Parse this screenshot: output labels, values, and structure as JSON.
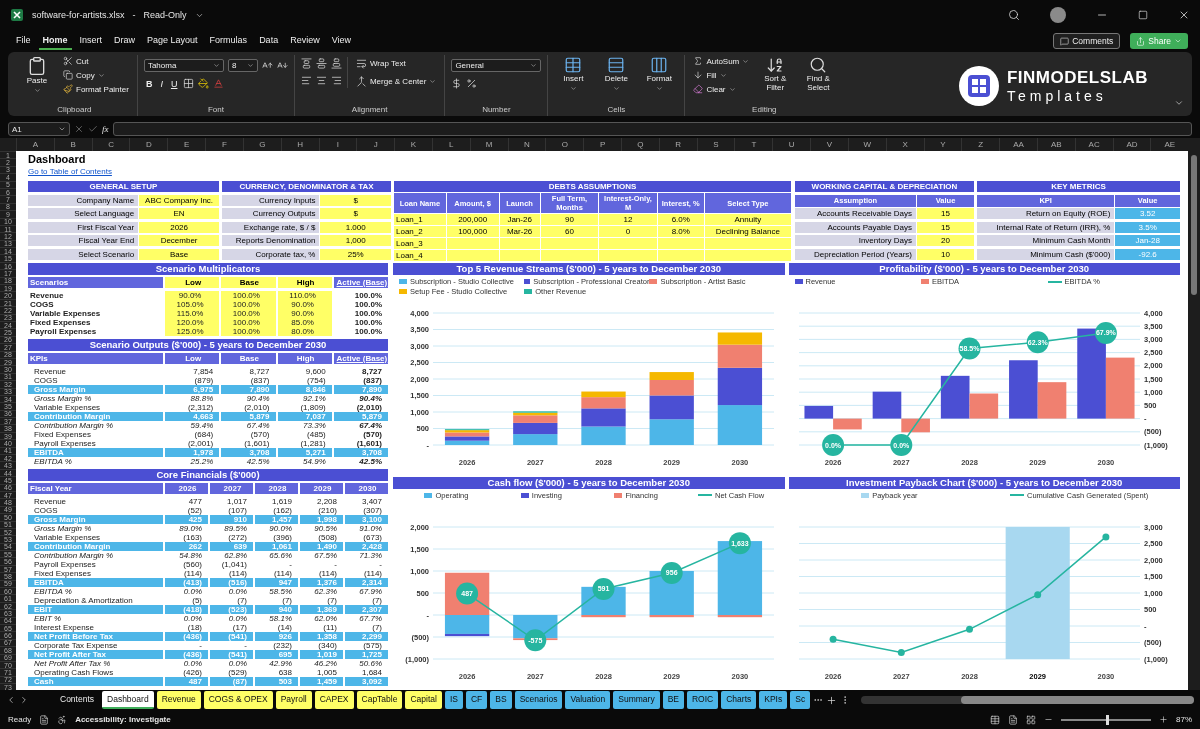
{
  "title_bar": {
    "file": "software-for-artists.xlsx",
    "separator": "-",
    "mode": "Read-Only"
  },
  "menu": [
    {
      "label": "File",
      "selected": false
    },
    {
      "label": "Home",
      "selected": true
    },
    {
      "label": "Insert",
      "selected": false
    },
    {
      "label": "Draw",
      "selected": false
    },
    {
      "label": "Page Layout",
      "selected": false
    },
    {
      "label": "Formulas",
      "selected": false
    },
    {
      "label": "Data",
      "selected": false
    },
    {
      "label": "Review",
      "selected": false
    },
    {
      "label": "View",
      "selected": false
    }
  ],
  "menu_actions": {
    "comments": "Comments",
    "share": "Share"
  },
  "ribbon": {
    "clipboard": {
      "paste": "Paste",
      "cut": "Cut",
      "copy": "Copy",
      "format_painter": "Format Painter",
      "label": "Clipboard"
    },
    "font": {
      "family": "Tahoma",
      "size": "8",
      "styles": [
        "B",
        "I",
        "U"
      ],
      "label": "Font"
    },
    "alignment": {
      "wrap": "Wrap Text",
      "merge": "Merge & Center",
      "label": "Alignment"
    },
    "number": {
      "format": "General",
      "label": "Number"
    },
    "cells": {
      "buttons": [
        "Insert",
        "Delete",
        "Format"
      ],
      "label": "Cells"
    },
    "editing": {
      "autosum": "AutoSum",
      "fill": "Fill",
      "clear": "Clear",
      "sort": "Sort & Filter",
      "find": "Find & Select",
      "label": "Editing"
    },
    "logo": {
      "name": "FINMODELSLAB",
      "tagline": "Templates"
    }
  },
  "formula_bar": {
    "cell": "A1",
    "fx": "fx"
  },
  "columns": [
    "A",
    "B",
    "C",
    "D",
    "E",
    "F",
    "G",
    "H",
    "I",
    "J",
    "K",
    "L",
    "M",
    "N",
    "O",
    "P",
    "Q",
    "R",
    "S",
    "T",
    "U",
    "V",
    "W",
    "X",
    "Y",
    "Z",
    "AA",
    "AB",
    "AC",
    "AD",
    "AE"
  ],
  "rows": [
    "1",
    "2",
    "3",
    "4",
    "5",
    "6",
    "7",
    "8",
    "9",
    "10",
    "11",
    "12",
    "13",
    "14",
    "15",
    "16",
    "17",
    "18",
    "19",
    "20",
    "21",
    "22",
    "23",
    "24",
    "25",
    "26",
    "27",
    "28",
    "29",
    "30",
    "31",
    "32",
    "33",
    "34",
    "35",
    "36",
    "37",
    "38",
    "39",
    "40",
    "41",
    "42",
    "43",
    "44",
    "45",
    "46",
    "47",
    "48",
    "49",
    "50",
    "51",
    "52",
    "53",
    "54",
    "55",
    "56",
    "57",
    "58",
    "59",
    "60",
    "61",
    "62",
    "63",
    "64",
    "65",
    "66",
    "67",
    "68",
    "69",
    "70",
    "71",
    "72",
    "73"
  ],
  "sheet": {
    "title": "Dashboard",
    "link": "Go to Table of Contents",
    "general_setup": {
      "title": "GENERAL SETUP",
      "rows": [
        {
          "label": "Company Name",
          "value": "ABC Company Inc."
        },
        {
          "label": "Select Language",
          "value": "EN"
        },
        {
          "label": "First Fiscal Year",
          "value": "2026"
        },
        {
          "label": "Fiscal Year End",
          "value": "December"
        },
        {
          "label": "Select Scenario",
          "value": "Base"
        }
      ]
    },
    "currency": {
      "title": "CURRENCY, DENOMINATOR & TAX",
      "rows": [
        {
          "label": "Currency Inputs",
          "value": "$"
        },
        {
          "label": "Currency Outputs",
          "value": "$"
        },
        {
          "label": "Exchange rate, $ / $",
          "value": "1.000"
        },
        {
          "label": "Reports Denomination",
          "value": "1,000"
        },
        {
          "label": "Corporate tax, %",
          "value": "25%"
        }
      ]
    },
    "debts": {
      "title": "DEBTS ASSUMPTIONS",
      "columns": [
        "Loan Name",
        "Amount, $",
        "Launch",
        "Full Term, Months",
        "Interest-Only, M",
        "Interest, %",
        "Select Type"
      ],
      "rows": [
        {
          "cells": [
            "Loan_1",
            "200,000",
            "Jan-26",
            "90",
            "12",
            "6.0%",
            "Annuity"
          ]
        },
        {
          "cells": [
            "Loan_2",
            "100,000",
            "Mar-26",
            "60",
            "0",
            "8.0%",
            "Declining Balance"
          ]
        },
        {
          "cells": [
            "Loan_3"
          ]
        },
        {
          "cells": [
            "Loan_4"
          ]
        }
      ]
    },
    "working_capital": {
      "title": "WORKING CAPITAL & DEPRECIATION",
      "kind": "input",
      "columns": [
        "Assumption",
        "Value"
      ],
      "rows": [
        {
          "label": "Accounts Receivable Days",
          "value": "15"
        },
        {
          "label": "Accounts Payable Days",
          "value": "15"
        },
        {
          "label": "Inventory Days",
          "value": "20"
        },
        {
          "label": "Depreciation Period (Years)",
          "value": "10"
        }
      ]
    },
    "key_metrics": {
      "title": "KEY METRICS",
      "kind": "output",
      "columns": [
        "KPI",
        "Value"
      ],
      "rows": [
        {
          "label": "Return on Equity (ROE)",
          "value": "3.52"
        },
        {
          "label": "Internal Rate of Return (IRR), %",
          "value": "3.5%"
        },
        {
          "label": "Minimum Cash Month",
          "value": "Jan-28"
        },
        {
          "label": "Minimum Cash ($'000)",
          "value": "-92.6"
        }
      ]
    },
    "tables": [
      {
        "title": "Scenario Multiplicators",
        "kind": "input",
        "emphasize_last": true,
        "columns": [
          "Scenarios",
          "Low",
          "Base",
          "High",
          "Active (Base)"
        ],
        "rows": [
          {
            "kind": "item",
            "cells": [
              "Revenue",
              "90.0%",
              "100.0%",
              "110.0%",
              "100.0%"
            ]
          },
          {
            "kind": "item",
            "cells": [
              "COGS",
              "105.0%",
              "100.0%",
              "90.0%",
              "100.0%"
            ]
          },
          {
            "kind": "item",
            "cells": [
              "Variable Expenses",
              "115.0%",
              "100.0%",
              "90.0%",
              "100.0%"
            ]
          },
          {
            "kind": "item",
            "cells": [
              "Fixed Expenses",
              "120.0%",
              "100.0%",
              "85.0%",
              "100.0%"
            ]
          },
          {
            "kind": "item",
            "cells": [
              "Payroll Expenses",
              "125.0%",
              "100.0%",
              "80.0%",
              "100.0%"
            ]
          }
        ]
      },
      {
        "title": "Scenario Outputs ($'000) - 5 years to December 2030",
        "kind": "output",
        "emphasize_last": true,
        "columns": [
          "KPIs",
          "Low",
          "Base",
          "High",
          "Active (Base)"
        ],
        "rows": [
          {
            "kind": "line",
            "cells": [
              "Revenue",
              "7,854",
              "8,727",
              "9,600",
              "8,727"
            ]
          },
          {
            "kind": "line",
            "cells": [
              "COGS",
              "(879)",
              "(837)",
              "(754)",
              "(837)"
            ]
          },
          {
            "kind": "total",
            "cells": [
              "Gross Margin",
              "6,975",
              "7,890",
              "8,846",
              "7,890"
            ]
          },
          {
            "kind": "pct",
            "cells": [
              "Gross Margin %",
              "88.8%",
              "90.4%",
              "92.1%",
              "90.4%"
            ]
          },
          {
            "kind": "line",
            "cells": [
              "Variable Expenses",
              "(2,312)",
              "(2,010)",
              "(1,809)",
              "(2,010)"
            ]
          },
          {
            "kind": "total",
            "cells": [
              "Contribution Margin",
              "4,663",
              "5,879",
              "7,037",
              "5,879"
            ]
          },
          {
            "kind": "pct",
            "cells": [
              "Contribution Margin %",
              "59.4%",
              "67.4%",
              "73.3%",
              "67.4%"
            ]
          },
          {
            "kind": "line",
            "cells": [
              "Fixed Expenses",
              "(684)",
              "(570)",
              "(485)",
              "(570)"
            ]
          },
          {
            "kind": "line",
            "cells": [
              "Payroll Expenses",
              "(2,001)",
              "(1,601)",
              "(1,281)",
              "(1,601)"
            ]
          },
          {
            "kind": "total",
            "cells": [
              "EBITDA",
              "1,978",
              "3,708",
              "5,271",
              "3,708"
            ]
          },
          {
            "kind": "pct",
            "cells": [
              "EBITDA %",
              "25.2%",
              "42.5%",
              "54.9%",
              "42.5%"
            ]
          }
        ]
      },
      {
        "title": "Core Financials ($'000)",
        "kind": "output",
        "emphasize_last": false,
        "columns": [
          "Fiscal Year",
          "2026",
          "2027",
          "2028",
          "2029",
          "2030"
        ],
        "rows": [
          {
            "kind": "line",
            "cells": [
              "Revenue",
              "477",
              "1,017",
              "1,619",
              "2,208",
              "3,407"
            ]
          },
          {
            "kind": "line",
            "cells": [
              "COGS",
              "(52)",
              "(107)",
              "(162)",
              "(210)",
              "(307)"
            ]
          },
          {
            "kind": "total",
            "cells": [
              "Gross Margin",
              "425",
              "910",
              "1,457",
              "1,998",
              "3,100"
            ]
          },
          {
            "kind": "pct",
            "cells": [
              "Gross Margin %",
              "89.0%",
              "89.5%",
              "90.0%",
              "90.5%",
              "91.0%"
            ]
          },
          {
            "kind": "line",
            "cells": [
              "Variable Expenses",
              "(163)",
              "(272)",
              "(396)",
              "(508)",
              "(673)"
            ]
          },
          {
            "kind": "total",
            "cells": [
              "Contribution Margin",
              "262",
              "639",
              "1,061",
              "1,490",
              "2,428"
            ]
          },
          {
            "kind": "pct",
            "cells": [
              "Contribution Margin %",
              "54.8%",
              "62.8%",
              "65.6%",
              "67.5%",
              "71.3%"
            ]
          },
          {
            "kind": "line",
            "cells": [
              "Payroll Expenses",
              "(560)",
              "(1,041)",
              "-",
              "-",
              "-"
            ]
          },
          {
            "kind": "line",
            "cells": [
              "Fixed Expenses",
              "(114)",
              "(114)",
              "(114)",
              "(114)",
              "(114)"
            ]
          },
          {
            "kind": "total",
            "cells": [
              "EBITDA",
              "(413)",
              "(516)",
              "947",
              "1,376",
              "2,314"
            ]
          },
          {
            "kind": "pct",
            "cells": [
              "EBITDA %",
              "0.0%",
              "0.0%",
              "58.5%",
              "62.3%",
              "67.9%"
            ]
          },
          {
            "kind": "line",
            "cells": [
              "Depreciation & Amortization",
              "(5)",
              "(7)",
              "(7)",
              "(7)",
              "(7)"
            ]
          },
          {
            "kind": "total",
            "cells": [
              "EBIT",
              "(418)",
              "(523)",
              "940",
              "1,369",
              "2,307"
            ]
          },
          {
            "kind": "pct",
            "cells": [
              "EBIT %",
              "0.0%",
              "0.0%",
              "58.1%",
              "62.0%",
              "67.7%"
            ]
          },
          {
            "kind": "line",
            "cells": [
              "Interest Expense",
              "(18)",
              "(17)",
              "(14)",
              "(11)",
              "(7)"
            ]
          },
          {
            "kind": "total",
            "cells": [
              "Net Profit Before Tax",
              "(436)",
              "(541)",
              "926",
              "1,358",
              "2,299"
            ]
          },
          {
            "kind": "line",
            "cells": [
              "Corporate Tax Expense",
              "-",
              "-",
              "(232)",
              "(340)",
              "(575)"
            ]
          },
          {
            "kind": "total",
            "cells": [
              "Net Profit After Tax",
              "(436)",
              "(541)",
              "695",
              "1,019",
              "1,725"
            ]
          },
          {
            "kind": "pct",
            "cells": [
              "Net Profit After Tax %",
              "0.0%",
              "0.0%",
              "42.9%",
              "46.2%",
              "50.6%"
            ]
          },
          {
            "kind": "line",
            "cells": [
              "Operating Cash Flows",
              "(426)",
              "(529)",
              "638",
              "1,005",
              "1,684"
            ]
          },
          {
            "kind": "total",
            "cells": [
              "Cash",
              "487",
              "(87)",
              "503",
              "1,459",
              "3,092"
            ]
          }
        ]
      }
    ],
    "charts": [
      {
        "chart_data": {
          "type": "bar",
          "stacked": true,
          "grid": true,
          "legend": true,
          "title": "Top 5 Revenue Streams ($'000) - 5 years to December 2030",
          "categories": [
            "2026",
            "2027",
            "2028",
            "2029",
            "2030"
          ],
          "ylim": [
            0,
            4000
          ],
          "yticks": [
            {
              "value": 0,
              "label": "-"
            },
            {
              "value": 500,
              "label": "500"
            },
            {
              "value": 1000,
              "label": "1,000"
            },
            {
              "value": 1500,
              "label": "1,500"
            },
            {
              "value": 2000,
              "label": "2,000"
            },
            {
              "value": 2500,
              "label": "2,500"
            },
            {
              "value": 3000,
              "label": "3,000"
            },
            {
              "value": 3500,
              "label": "3,500"
            },
            {
              "value": 4000,
              "label": "4,000"
            }
          ],
          "series": [
            {
              "name": "Subscription - Studio Collective",
              "color": "#4db6e8",
              "values": [
                130,
                330,
                560,
                780,
                1210
              ]
            },
            {
              "name": "Subscription - Professional Creator",
              "color": "#4b4fd3",
              "values": [
                130,
                340,
                550,
                720,
                1130
              ]
            },
            {
              "name": "Subscription - Artist Basic",
              "color": "#f08070",
              "values": [
                120,
                230,
                340,
                470,
                700
              ]
            },
            {
              "name": "Setup Fee - Studio Collective",
              "color": "#f5b800",
              "values": [
                70,
                80,
                170,
                240,
                370
              ]
            },
            {
              "name": "Other Revenue",
              "color": "#26b5a0",
              "values": [
                30,
                40,
                0,
                0,
                0
              ]
            }
          ]
        }
      },
      {
        "chart_data": {
          "type": "bar",
          "grid": true,
          "legend": true,
          "title": "Profitability ($'000) - 5 years to December 2030",
          "categories": [
            "2026",
            "2027",
            "2028",
            "2029",
            "2030"
          ],
          "ylim": [
            -1000,
            4000
          ],
          "y2lim": [
            0,
            80
          ],
          "yticks": [
            {
              "value": -1000,
              "label": "(1,000)"
            },
            {
              "value": -500,
              "label": "(500)"
            },
            {
              "value": 0,
              "label": "-"
            },
            {
              "value": 500,
              "label": "500"
            },
            {
              "value": 1000,
              "label": "1,000"
            },
            {
              "value": 1500,
              "label": "1,500"
            },
            {
              "value": 2000,
              "label": "2,000"
            },
            {
              "value": 2500,
              "label": "2,500"
            },
            {
              "value": 3000,
              "label": "3,000"
            },
            {
              "value": 3500,
              "label": "3,500"
            },
            {
              "value": 4000,
              "label": "4,000"
            }
          ],
          "series": [
            {
              "name": "Revenue",
              "color": "#4b4fd3",
              "values": [
                480,
                1020,
                1620,
                2210,
                3410
              ]
            },
            {
              "name": "EBITDA",
              "color": "#f08070",
              "values": [
                -410,
                -520,
                950,
                1380,
                2310
              ]
            },
            {
              "name": "EBITDA %",
              "type": "line",
              "axis": "y2",
              "marker": "circle",
              "color": "#26b5a0",
              "values": [
                0,
                0,
                58.5,
                62.3,
                67.9
              ],
              "value_labels": [
                "0.0%",
                "0.0%",
                "58.5%",
                "62.3%",
                "67.9%"
              ]
            }
          ]
        }
      },
      {
        "chart_data": {
          "type": "bar",
          "stacked": true,
          "grid": true,
          "legend": true,
          "title": "Cash flow ($'000) - 5 years to December 2030",
          "categories": [
            "2026",
            "2027",
            "2028",
            "2029",
            "2030"
          ],
          "ylim": [
            -1000,
            2000
          ],
          "yticks": [
            {
              "value": -1000,
              "label": "(1,000)"
            },
            {
              "value": -500,
              "label": "(500)"
            },
            {
              "value": 0,
              "label": "-"
            },
            {
              "value": 500,
              "label": "500"
            },
            {
              "value": 1000,
              "label": "1,000"
            },
            {
              "value": 1500,
              "label": "1,500"
            },
            {
              "value": 2000,
              "label": "2,000"
            }
          ],
          "series": [
            {
              "name": "Operating",
              "color": "#4db6e8",
              "values": [
                -430,
                -530,
                640,
                1000,
                1680
              ]
            },
            {
              "name": "Investing",
              "color": "#4b4fd3",
              "values": [
                -50,
                null,
                0,
                0,
                0
              ]
            },
            {
              "name": "Financing",
              "color": "#f08070",
              "values": [
                960,
                -40,
                -50,
                -50,
                -50
              ]
            },
            {
              "name": "Net Cash Flow",
              "type": "line",
              "marker": "circle",
              "color": "#26b5a0",
              "values": [
                487,
                -575,
                591,
                956,
                1633
              ],
              "value_labels": [
                "487",
                "-575",
                "591",
                "956",
                "1,633"
              ]
            }
          ]
        }
      },
      {
        "chart_data": {
          "type": "line",
          "grid": true,
          "legend": true,
          "title": "Investment Payback Chart ($'000) - 5 years to December 2030",
          "categories": [
            "2026",
            "2027",
            "2028",
            "2029",
            "2030"
          ],
          "ylim": [
            -1000,
            3000
          ],
          "yticks": [
            {
              "value": -1000,
              "label": "(1,000)"
            },
            {
              "value": -500,
              "label": "(500)"
            },
            {
              "value": 0,
              "label": "-"
            },
            {
              "value": 500,
              "label": "500"
            },
            {
              "value": 1000,
              "label": "1,000"
            },
            {
              "value": 1500,
              "label": "1,500"
            },
            {
              "value": 2000,
              "label": "2,000"
            },
            {
              "value": 2500,
              "label": "2,500"
            },
            {
              "value": 3000,
              "label": "3,000"
            }
          ],
          "series": [
            {
              "name": "Cumulative Cash Generated (Spent)",
              "marker": "circle",
              "color": "#26b5a0",
              "values": [
                -400,
                -800,
                -100,
                950,
                2700
              ]
            }
          ]
        },
        "payback": {
          "label": "Payback year",
          "color": "#a8d8f0",
          "years": [
            {
              "selected": false
            },
            {
              "selected": false
            },
            {
              "selected": false
            },
            {
              "selected": true
            },
            {
              "selected": false
            }
          ]
        }
      }
    ]
  },
  "sheet_tabs": [
    {
      "label": "Contents",
      "selected": false
    },
    {
      "label": "Dashboard",
      "selected": true
    },
    {
      "label": "Revenue",
      "selected": false,
      "color": "#ffff66"
    },
    {
      "label": "COGS & OPEX",
      "selected": false,
      "color": "#ffff66"
    },
    {
      "label": "Payroll",
      "selected": false,
      "color": "#ffff66"
    },
    {
      "label": "CAPEX",
      "selected": false,
      "color": "#ffff66"
    },
    {
      "label": "CapTable",
      "selected": false,
      "color": "#ffff66"
    },
    {
      "label": "Capital",
      "selected": false,
      "color": "#ffff66"
    },
    {
      "label": "IS",
      "selected": false,
      "color": "#4db6e8"
    },
    {
      "label": "CF",
      "selected": false,
      "color": "#4db6e8"
    },
    {
      "label": "BS",
      "selected": false,
      "color": "#4db6e8"
    },
    {
      "label": "Scenarios",
      "selected": false,
      "color": "#4db6e8"
    },
    {
      "label": "Valuation",
      "selected": false,
      "color": "#4db6e8"
    },
    {
      "label": "Summary",
      "selected": false,
      "color": "#4db6e8"
    },
    {
      "label": "BE",
      "selected": false,
      "color": "#4db6e8"
    },
    {
      "label": "ROIC",
      "selected": false,
      "color": "#4db6e8"
    },
    {
      "label": "Charts",
      "selected": false,
      "color": "#4db6e8"
    },
    {
      "label": "KPIs",
      "selected": false,
      "color": "#4db6e8"
    },
    {
      "label": "Sc",
      "selected": false,
      "color": "#4db6e8"
    }
  ],
  "status_bar": {
    "state": "Ready",
    "accessibility": "Accessibility: Investigate",
    "zoom": {
      "level": 0.5,
      "reading": "87%"
    }
  }
}
